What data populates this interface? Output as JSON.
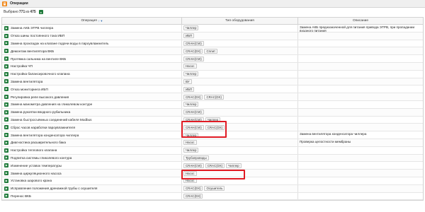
{
  "panel": {
    "title": "Операции",
    "title_icon": "document-icon"
  },
  "selection": {
    "prefix": "Выбрано",
    "selected": "771",
    "of": "из",
    "total": "475",
    "export_icon": "excel-export-icon"
  },
  "table": {
    "columns": [
      {
        "label": "Операция"
      },
      {
        "label": "Тип оборудования"
      },
      {
        "label": "Описание"
      }
    ],
    "sort_indicator": "↑ ▾",
    "rows": [
      {
        "operation": "Замена АКБ ЭТРВ чиллера",
        "equipment": [
          "Чиллер"
        ],
        "description": "Замена АКБ предназначенной для питания привода ЭТРВ, при пропадании входного питания"
      },
      {
        "operation": "Отказ шины постоянного тока ИБП",
        "equipment": [
          "ИБП"
        ],
        "description": ""
      },
      {
        "operation": "Замена прокладок на клапане подачи воды в пароувлажнитель",
        "equipment": [
          "CRAH(CW)"
        ],
        "description": ""
      },
      {
        "operation": "Демонтаж вентилятора ВКБ",
        "equipment": [
          "CRAC(DX)",
          "Сплит"
        ],
        "description": ""
      },
      {
        "operation": "Протяжка сальника на вентиле ВКБ",
        "equipment": [
          "CRAH(CW)"
        ],
        "description": ""
      },
      {
        "operation": "Настройка ЧП",
        "equipment": [
          "Насос"
        ],
        "description": ""
      },
      {
        "operation": "Настройка балансировочного клапана",
        "equipment": [
          "Чиллер"
        ],
        "description": ""
      },
      {
        "operation": "Замена вентилятора",
        "equipment": [
          "ВУ"
        ],
        "description": ""
      },
      {
        "operation": "Отказ мониторинга ИБП",
        "equipment": [
          "ИБП"
        ],
        "description": ""
      },
      {
        "operation": "Регулировка реле высокого давления",
        "equipment": [
          "CRAC(DX)",
          "CRAC(DX)"
        ],
        "description": ""
      },
      {
        "operation": "Замена манометра давления на гликолевом контуре",
        "equipment": [
          "Чиллер"
        ],
        "description": ""
      },
      {
        "operation": "Замена рукоятки вводного рубильника",
        "equipment": [
          "CRAH(CW)"
        ],
        "description": ""
      },
      {
        "operation": "Замена быстросъёмных соединений кабеля Modbus",
        "equipment": [
          "CRAH(CW)",
          "Чиллер"
        ],
        "description": ""
      },
      {
        "operation": "Сброс часов наработки пароувлажнителя",
        "equipment": [
          "CRAH(CW)",
          "CRAC(DX)"
        ],
        "description": ""
      },
      {
        "operation": "Замена вентилятора конденсатора чиллера",
        "equipment": [
          "Чиллер"
        ],
        "description": "Замена вентилятора конденсатора чиллера"
      },
      {
        "operation": "Диагностика расширительного бака",
        "equipment": [
          "Насос"
        ],
        "description": "Проверка целостности мембраны"
      },
      {
        "operation": "Настройка теплового клапана",
        "equipment": [
          "Чиллер"
        ],
        "description": ""
      },
      {
        "operation": "Подпитка системы гликолевого контура",
        "equipment": [
          "Трубопроводы"
        ],
        "description": ""
      },
      {
        "operation": "Изменение уставок температуры",
        "equipment": [
          "CRAH(CW)",
          "CRAC(DX)",
          "Чиллер"
        ],
        "description": ""
      },
      {
        "operation": "Замена циркуляционного насоса",
        "equipment": [
          "Насос"
        ],
        "description": ""
      },
      {
        "operation": "Установка шарового крана",
        "equipment": [
          "Насос"
        ],
        "description": ""
      },
      {
        "operation": "Исправление положения дренажной трубы с осушителя",
        "equipment": [
          "CRAC(DX)",
          "Осушитель"
        ],
        "description": ""
      },
      {
        "operation": "Перенос ВКБ",
        "equipment": [
          "CRAC(DX)"
        ],
        "description": ""
      }
    ]
  },
  "colors": {
    "accent_orange": "#f08a1e",
    "play_green": "#1f7a3a",
    "highlight_red": "#e01b24",
    "link_blue": "#2f6db4"
  }
}
